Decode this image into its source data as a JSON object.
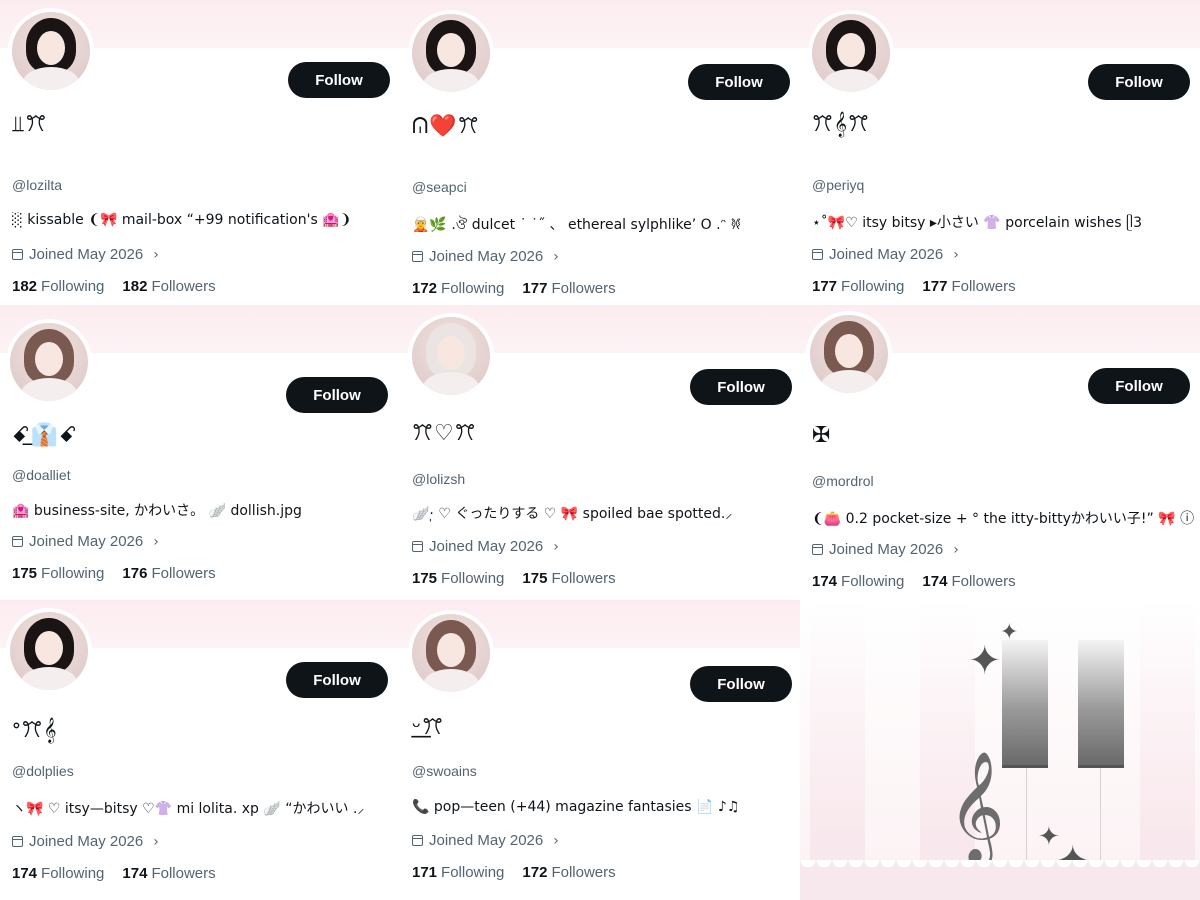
{
  "follow_label": "Follow",
  "following_label": "Following",
  "followers_label": "Followers",
  "profiles": [
    {
      "display_name": "⫫ꔫ",
      "handle": "@lozilta",
      "bio": "░ kissable ❨🎀 mail-box “+99 notification's 🏩❩",
      "joined": "Joined May 2026",
      "following": "182",
      "followers": "182"
    },
    {
      "display_name": "ᕬ❤️ꔫ",
      "handle": "@seapci",
      "bio": "🧝🌿 .ঔ dulcet ˙ ˙˝ 、 ethereal sylphlike’ O .ᵔ 𐦍",
      "joined": "Joined May 2026",
      "following": "172",
      "followers": "177"
    },
    {
      "display_name": "ꔫ𝄞ꔫ",
      "handle": "@periyq",
      "bio": "⋆˚🎀♡ itsy bitsy ▸小さい 👚 porcelain wishes ᥫ3",
      "joined": "Joined May 2026",
      "following": "177",
      "followers": "177"
    },
    {
      "display_name": "ꗃ͟👔ꗃ",
      "handle": "@doalliet",
      "bio": "🏩 business-site, かわいさ。 🪽 dollish.jpg",
      "joined": "Joined May 2026",
      "following": "175",
      "followers": "176"
    },
    {
      "display_name": "ꔫ♡ꔫ",
      "handle": "@lolizsh",
      "bio": "🪽·̩ ♡ ぐったりする ♡ 🎀 spoiled bae spotted.⸝",
      "joined": "Joined May 2026",
      "following": "175",
      "followers": "175"
    },
    {
      "display_name": "✠",
      "handle": "@mordrol",
      "bio": "❨👛 0.2 pocket-size + ° the itty-bittyかわいい子!” 🎀 ⓘ",
      "joined": "Joined May 2026",
      "following": "174",
      "followers": "174"
    },
    {
      "display_name": "ᐤꔫ𝄞",
      "handle": "@dolplies",
      "bio": "ヽ🎀 ♡ itsy—bitsy ♡👚 mi lolita. xp 🪽 “かわいい .⸝",
      "joined": "Joined May 2026",
      "following": "174",
      "followers": "174"
    },
    {
      "display_name": "ᵕ͟ꔫ",
      "handle": "@swoains",
      "bio": "📞 pop—teen (+44) magazine fantasies 📄 ♪♫",
      "joined": "Joined May 2026",
      "following": "171",
      "followers": "172"
    }
  ],
  "decor": {
    "clef": "𝄞",
    "sparkle": "✦"
  }
}
